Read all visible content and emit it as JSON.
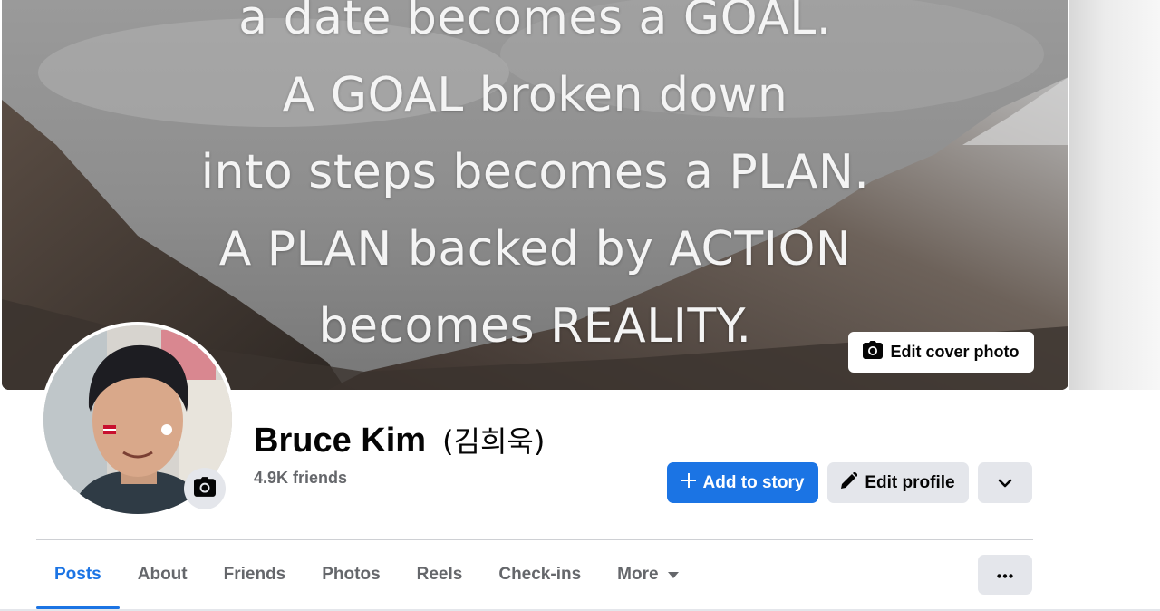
{
  "cover": {
    "quote_lines": [
      "a date becomes a GOAL.",
      "A GOAL broken down",
      "into steps becomes a PLAN.",
      "A PLAN backed by ACTION",
      "becomes REALITY."
    ],
    "edit_cover_label": "Edit cover photo"
  },
  "profile": {
    "name": "Bruce Kim",
    "alternate_name": "(김희욱)",
    "friends": "4.9K friends"
  },
  "actions": {
    "add_story_label": "Add to story",
    "edit_profile_label": "Edit profile"
  },
  "tabs": [
    {
      "label": "Posts",
      "active": true
    },
    {
      "label": "About"
    },
    {
      "label": "Friends"
    },
    {
      "label": "Photos"
    },
    {
      "label": "Reels"
    },
    {
      "label": "Check-ins"
    },
    {
      "label": "More"
    }
  ],
  "colors": {
    "accent": "#1b74e4",
    "secondary_button": "#e4e6eb",
    "muted_text": "#65676b"
  },
  "icons": [
    "camera-icon",
    "plus-icon",
    "pencil-icon",
    "chevron-down-icon",
    "caret-down-icon",
    "ellipsis-icon"
  ]
}
